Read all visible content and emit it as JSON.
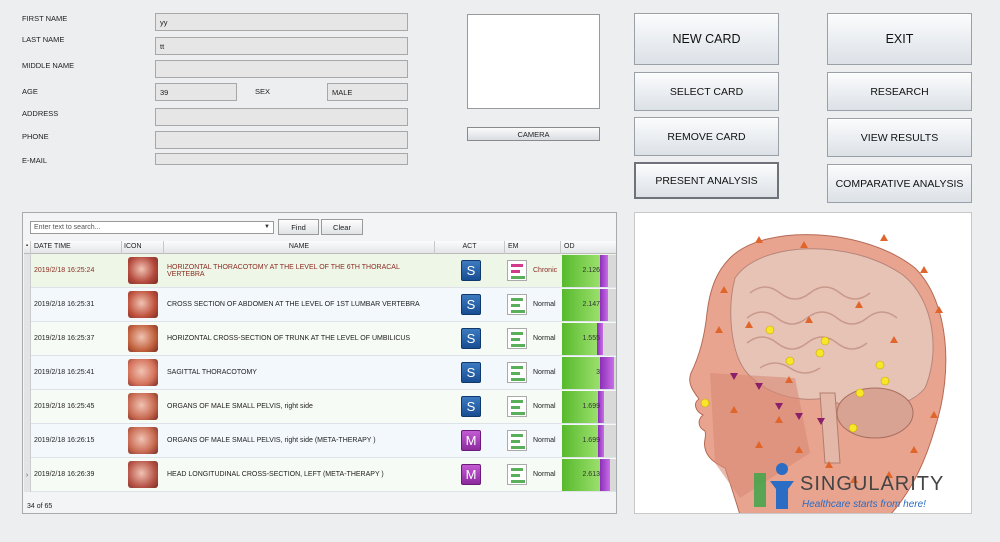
{
  "form": {
    "first_name_label": "FIRST NAME",
    "first_name_value": "yy",
    "last_name_label": "LAST NAME",
    "last_name_value": "tt",
    "middle_name_label": "MIDDLE NAME",
    "middle_name_value": "",
    "age_label": "AGE",
    "age_value": "39",
    "sex_label": "SEX",
    "sex_value": "MALE",
    "address_label": "ADDRESS",
    "address_value": "",
    "phone_label": "PHONE",
    "phone_value": "",
    "email_label": "E-MAIL",
    "email_value": ""
  },
  "camera": {
    "button_label": "CAMERA"
  },
  "actions": {
    "new_card": "NEW CARD",
    "exit": "EXIT",
    "select_card": "SELECT CARD",
    "research": "RESEARCH",
    "remove_card": "REMOVE CARD",
    "view_results": "VIEW RESULTS",
    "present_analysis": "PRESENT ANALYSIS",
    "comparative_analysis": "COMPARATIVE ANALYSIS"
  },
  "search": {
    "placeholder": "Enter text to search...",
    "find_label": "Find",
    "clear_label": "Clear"
  },
  "table": {
    "columns": [
      "DATE TIME",
      "ICON",
      "NAME",
      "ACT",
      "EM",
      "OD"
    ],
    "rows": [
      {
        "date": "2019/2/18 16:25:24",
        "name": "HORIZONTAL THORACOTOMY AT THE LEVEL OF THE 6TH THORACAL VERTEBRA",
        "act": "S",
        "em": "Chronic",
        "od": "2.126",
        "od_fraction": 0.38,
        "thumb": "#b4493d"
      },
      {
        "date": "2019/2/18 16:25:31",
        "name": "CROSS SECTION OF ABDOMEN AT THE LEVEL OF 1ST LUMBAR VERTEBRA",
        "act": "S",
        "em": "Normal",
        "od": "2.147",
        "od_fraction": 0.39,
        "thumb": "#c0543f"
      },
      {
        "date": "2019/2/18 16:25:37",
        "name": "HORIZONTAL CROSS-SECTION OF TRUNK AT THE LEVEL OF UMBILICUS",
        "act": "S",
        "em": "Normal",
        "od": "1.555",
        "od_fraction": 0.28,
        "thumb": "#c2633e"
      },
      {
        "date": "2019/2/18 16:25:41",
        "name": "SAGITTAL THORACOTOMY",
        "act": "S",
        "em": "Normal",
        "od": "3",
        "od_fraction": 0.72,
        "thumb": "#d4715a"
      },
      {
        "date": "2019/2/18 16:25:45",
        "name": "ORGANS OF MALE SMALL PELVIS, right side",
        "act": "S",
        "em": "Normal",
        "od": "1.699",
        "od_fraction": 0.3,
        "thumb": "#c86a52"
      },
      {
        "date": "2019/2/18 16:26:15",
        "name": "ORGANS OF MALE SMALL PELVIS, right side (META-THERAPY )",
        "act": "M",
        "em": "Normal",
        "od": "1.699",
        "od_fraction": 0.3,
        "thumb": "#c86a52"
      },
      {
        "date": "2019/2/18 16:26:39",
        "name": "HEAD LONGITUDINAL CROSS-SECTION, LEFT (META-THERAPY )",
        "act": "M",
        "em": "Normal",
        "od": "2.613",
        "od_fraction": 0.5,
        "thumb": "#b8574a"
      }
    ],
    "record_count": "34 of 65"
  },
  "brand": {
    "name": "SINGULARITY",
    "tagline": "Healthcare starts from here!"
  },
  "colors": {
    "chronic_text": "#8b2c20",
    "normal_text": "#222222",
    "brand_blue": "#2b6cc4",
    "brand_green": "#3fa64a"
  }
}
